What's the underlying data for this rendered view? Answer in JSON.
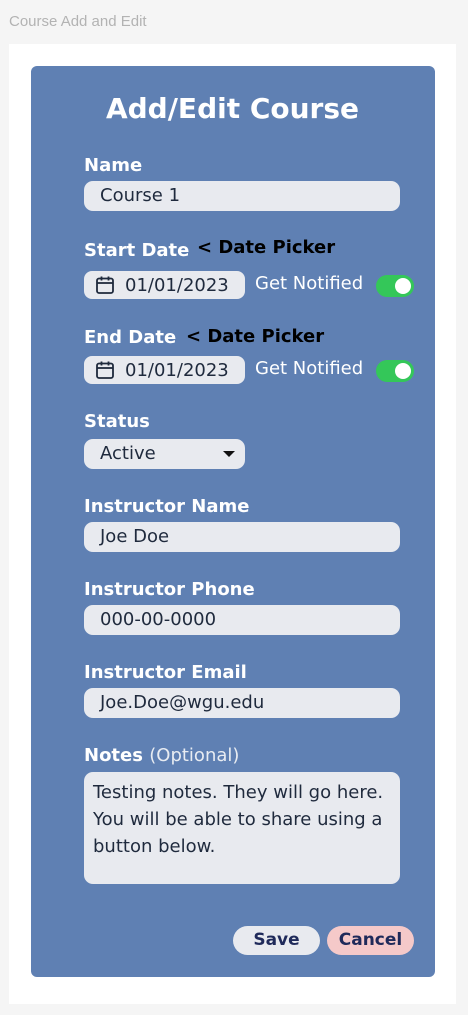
{
  "frame_title": "Course Add and Edit",
  "title": "Add/Edit Course",
  "name": {
    "label": "Name",
    "value": "Course 1"
  },
  "start_date": {
    "label": "Start Date",
    "hint": "< Date Picker",
    "value": "01/01/2023",
    "notify_label": "Get Notified",
    "notify_on": true
  },
  "end_date": {
    "label": "End Date",
    "hint": "< Date Picker",
    "value": "01/01/2023",
    "notify_label": "Get Notified",
    "notify_on": true
  },
  "status": {
    "label": "Status",
    "value": "Active"
  },
  "instructor_name": {
    "label": "Instructor Name",
    "value": "Joe Doe"
  },
  "instructor_phone": {
    "label": "Instructor Phone",
    "value": "000-00-0000"
  },
  "instructor_email": {
    "label": "Instructor Email",
    "value": "Joe.Doe@wgu.edu"
  },
  "notes": {
    "label": "Notes",
    "optional": "(Optional)",
    "value": "Testing notes. They will go here. You will be able to share using a button below."
  },
  "buttons": {
    "save": "Save",
    "cancel": "Cancel"
  },
  "colors": {
    "card": "#5f80b3",
    "field": "#e8eaef",
    "toggle_on": "#34c759",
    "cancel_bg": "#f5c9c9"
  },
  "icons": {
    "date": "calendar-icon",
    "dropdown": "chevron-down-icon"
  }
}
